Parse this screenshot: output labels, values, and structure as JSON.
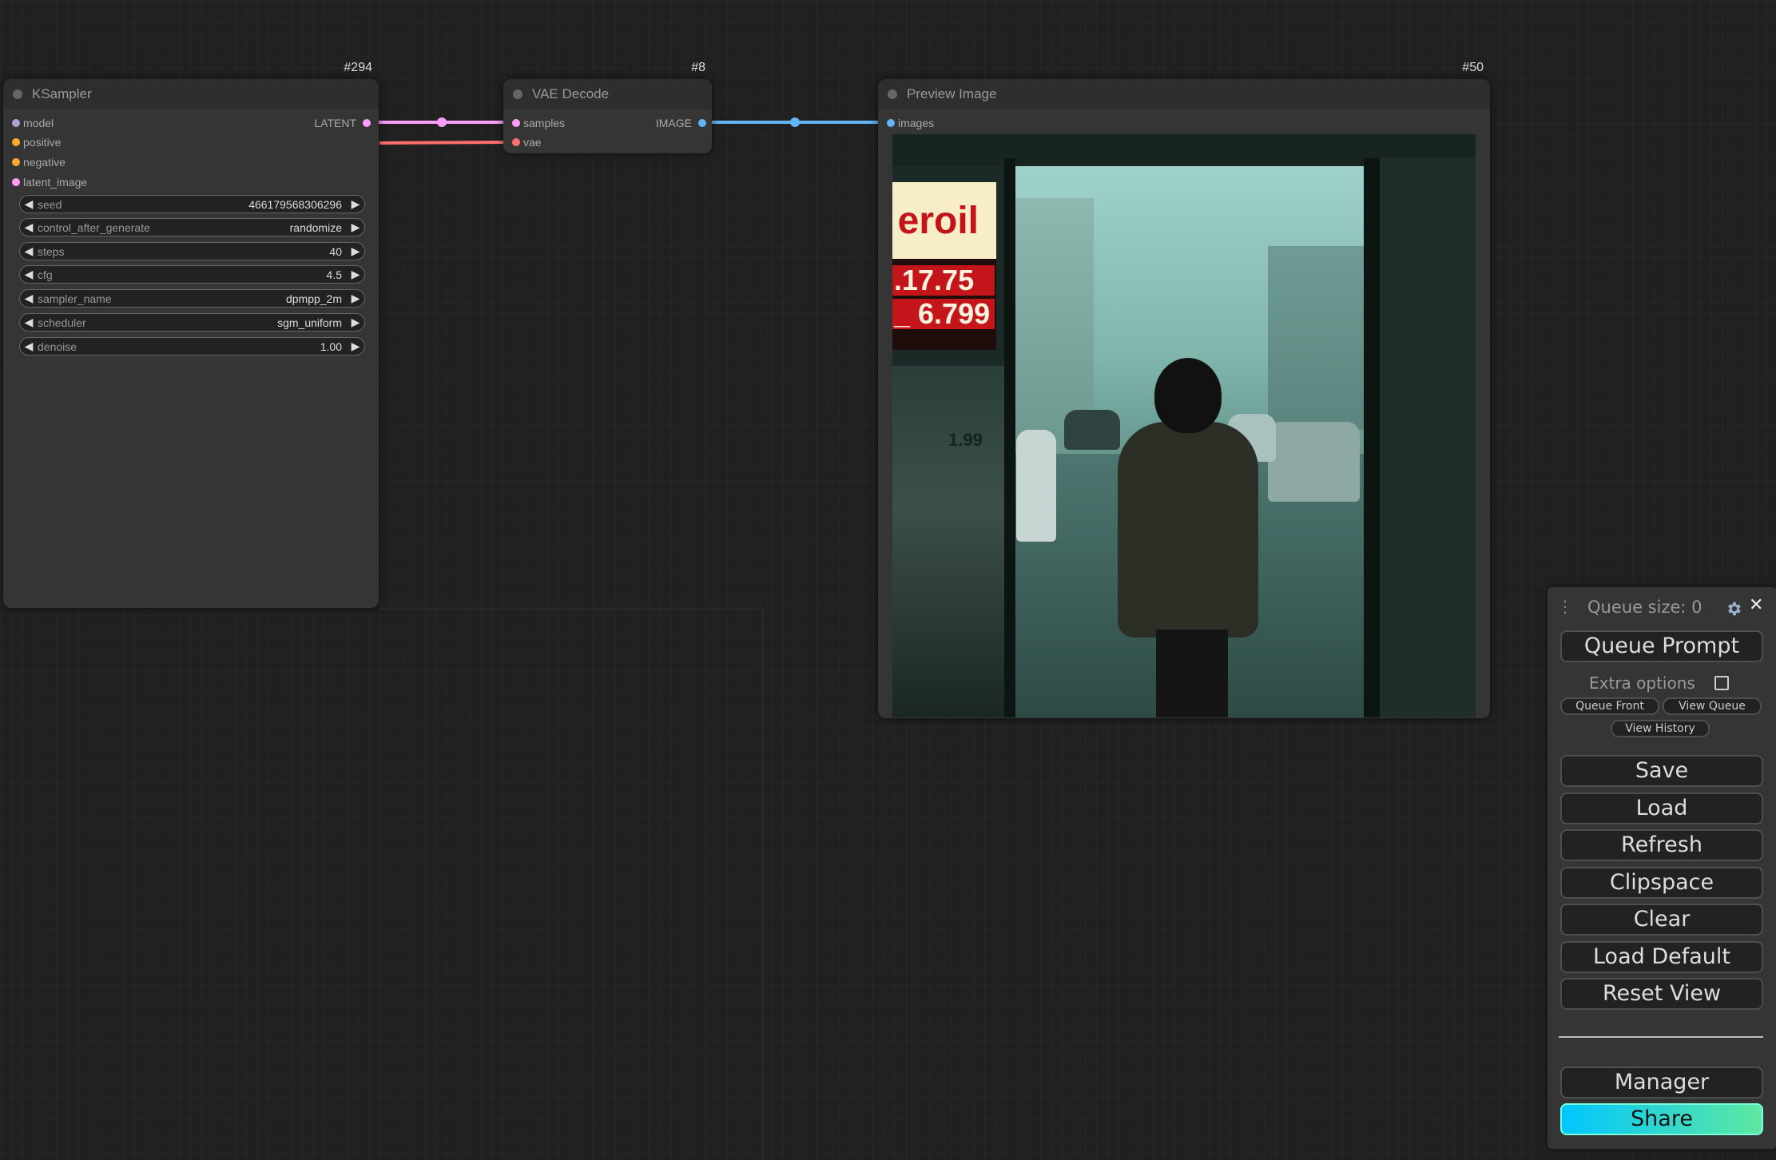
{
  "ksampler": {
    "title": "KSampler",
    "id": "#294",
    "inputs": [
      "model",
      "positive",
      "negative",
      "latent_image"
    ],
    "output": "LATENT",
    "widgets": [
      {
        "name": "seed",
        "value": "466179568306296"
      },
      {
        "name": "control_after_generate",
        "value": "randomize"
      },
      {
        "name": "steps",
        "value": "40"
      },
      {
        "name": "cfg",
        "value": "4.5"
      },
      {
        "name": "sampler_name",
        "value": "dpmpp_2m"
      },
      {
        "name": "scheduler",
        "value": "sgm_uniform"
      },
      {
        "name": "denoise",
        "value": "1.00"
      }
    ]
  },
  "vae_decode": {
    "title": "VAE Decode",
    "id": "#8",
    "inputs": [
      "samples",
      "vae"
    ],
    "output": "IMAGE"
  },
  "preview": {
    "title": "Preview Image",
    "id": "#50",
    "input": "images",
    "sign": {
      "brand": "eroil",
      "price1": ".17.75",
      "price2": "_ 6.799",
      "small": "1.99"
    }
  },
  "arrows": {
    "left": "◀",
    "right": "▶"
  },
  "menu": {
    "drag_handle": "⋮",
    "queue_size": "Queue size: 0",
    "queue_prompt": "Queue Prompt",
    "extra_options": "Extra options",
    "queue_front": "Queue Front",
    "view_queue": "View Queue",
    "view_history": "View History",
    "save": "Save",
    "load": "Load",
    "refresh": "Refresh",
    "clipspace": "Clipspace",
    "clear": "Clear",
    "load_default": "Load Default",
    "reset_view": "Reset View",
    "manager": "Manager",
    "share": "Share",
    "close": "✕"
  },
  "colors": {
    "latent": "#ff9cf9",
    "vae": "#ff6e6e",
    "image": "#64b5f6",
    "model": "#b39ddb",
    "conditioning": "#ffa931"
  }
}
